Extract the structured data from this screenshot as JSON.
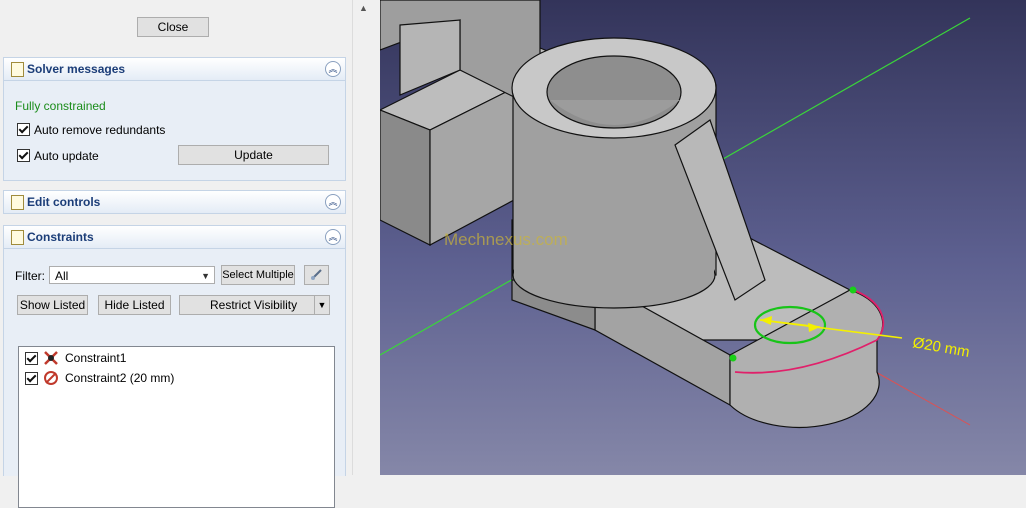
{
  "panel": {
    "close_label": "Close",
    "solver": {
      "title": "Solver messages",
      "status": "Fully constrained",
      "status_color": "#1a8c1a",
      "auto_remove_label": "Auto remove redundants",
      "auto_update_label": "Auto update",
      "update_label": "Update"
    },
    "edit_controls": {
      "title": "Edit controls"
    },
    "constraints": {
      "title": "Constraints",
      "filter_label": "Filter:",
      "filter_value": "All",
      "select_multiple_label": "Select Multiple",
      "show_listed_label": "Show Listed",
      "hide_listed_label": "Hide Listed",
      "restrict_visibility_label": "Restrict Visibility",
      "items": [
        {
          "label": "Constraint1",
          "icon": "coincident-constraint-icon",
          "checked": true
        },
        {
          "label": "Constraint2 (20 mm)",
          "icon": "diameter-constraint-icon",
          "checked": true
        }
      ]
    }
  },
  "viewport": {
    "watermark": "Mechnexus.com",
    "dimension_label": "Ø20 mm",
    "colors": {
      "dimension": "#f4f000",
      "circle": "#18c418",
      "axis_green": "#3ad63a",
      "axis_red": "#e05050",
      "edge_highlight": "#e0206a"
    }
  }
}
